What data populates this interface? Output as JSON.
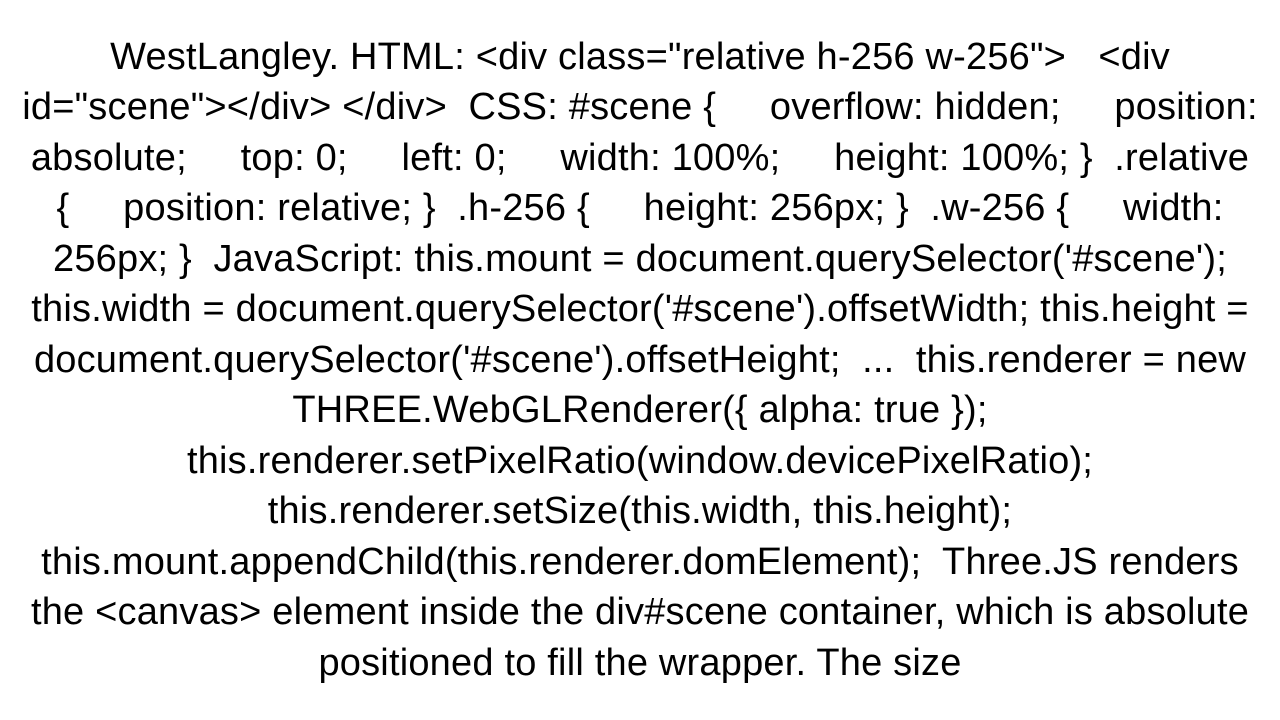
{
  "body_text": "WestLangley. HTML: <div class=\"relative h-256 w-256\">   <div id=\"scene\"></div> </div>  CSS: #scene {     overflow: hidden;     position: absolute;     top: 0;     left: 0;     width: 100%;     height: 100%; }  .relative {     position: relative; }  .h-256 {     height: 256px; }  .w-256 {     width: 256px; }  JavaScript: this.mount = document.querySelector('#scene');  this.width = document.querySelector('#scene').offsetWidth; this.height = document.querySelector('#scene').offsetHeight;  ...  this.renderer = new THREE.WebGLRenderer({ alpha: true }); this.renderer.setPixelRatio(window.devicePixelRatio); this.renderer.setSize(this.width, this.height); this.mount.appendChild(this.renderer.domElement);  Three.JS renders the <canvas> element inside the div#scene container, which is absolute positioned to fill the wrapper. The size"
}
